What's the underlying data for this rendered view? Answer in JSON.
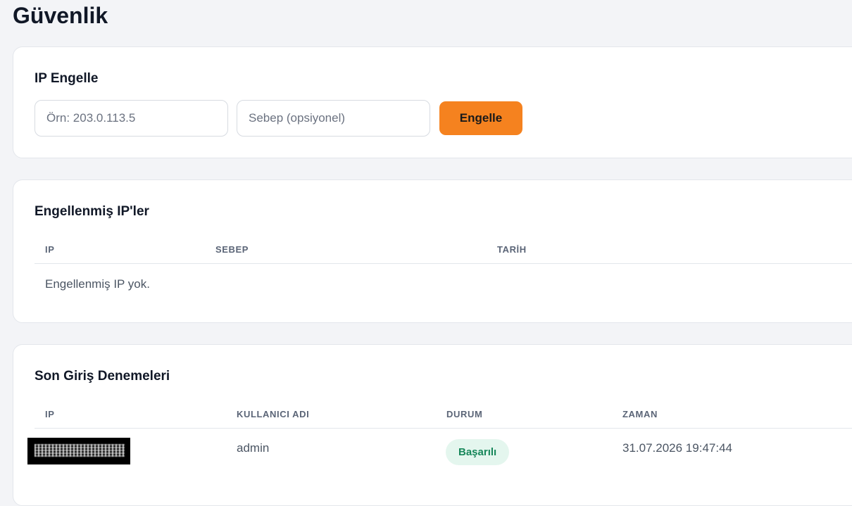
{
  "page": {
    "title": "Güvenlik"
  },
  "block_ip": {
    "title": "IP Engelle",
    "ip_placeholder": "Örn: 203.0.113.5",
    "ip_value": "",
    "reason_placeholder": "Sebep (opsiyonel)",
    "reason_value": "",
    "submit_label": "Engelle",
    "accent_color": "#f5821f"
  },
  "blocked_ips": {
    "title": "Engellenmiş IP'ler",
    "columns": [
      "IP",
      "SEBEP",
      "TARİH"
    ],
    "rows": [],
    "empty_message": "Engellenmiş IP yok."
  },
  "login_attempts": {
    "title": "Son Giriş Denemeleri",
    "columns": [
      "IP",
      "KULLANICI ADI",
      "DURUM",
      "ZAMAN"
    ],
    "rows": [
      {
        "username": "admin",
        "status": "Başarılı",
        "status_color": "#17875a",
        "time": "31.07.2026 19:47:44"
      }
    ]
  }
}
